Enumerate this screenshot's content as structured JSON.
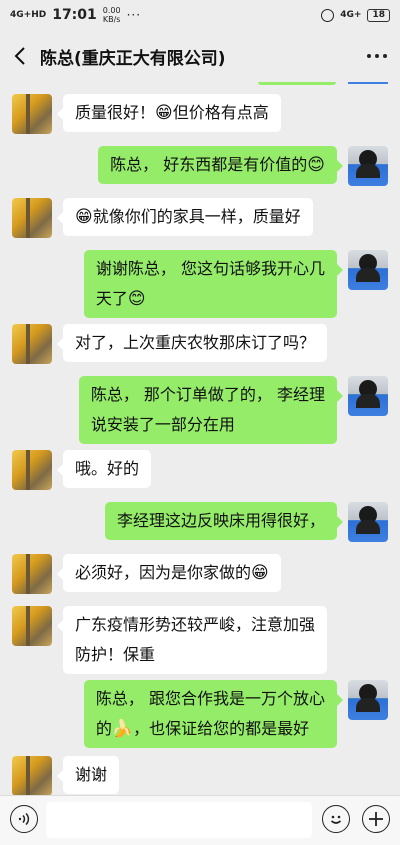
{
  "status_bar": {
    "signal": "4G+HD",
    "time": "17:01",
    "speed_value": "0.00",
    "speed_unit": "KB/s",
    "dots": "···",
    "signal_right": "4G+",
    "battery": "18"
  },
  "header": {
    "title": "陈总(重庆正大有限公司)"
  },
  "messages": [
    {
      "side": "left",
      "text": "质量很好！",
      "emoji": "😁",
      "tail": "但价格有点高"
    },
    {
      "side": "right",
      "text": "陈总， 好东西都是有价值的",
      "emoji": "😊"
    },
    {
      "side": "left",
      "emoji": "😁",
      "text": "就像你们的家具一样，质量好"
    },
    {
      "side": "right",
      "line1": "谢谢陈总， 您这句话够我开心几",
      "line2": "天了",
      "emoji": "😊"
    },
    {
      "side": "left",
      "text": "对了，上次重庆农牧那床订了吗？"
    },
    {
      "side": "right",
      "line1": "陈总， 那个订单做了的， 李经理",
      "line2": "说安装了一部分在用"
    },
    {
      "side": "left",
      "text": "哦。好的"
    },
    {
      "side": "right",
      "text": "李经理这边反映床用得很好，"
    },
    {
      "side": "left",
      "text": "必须好，因为是你家做的",
      "emoji": "😁"
    },
    {
      "side": "left",
      "line1": "广东疫情形势还较严峻，注意加强",
      "line2": "防护！保重"
    },
    {
      "side": "right",
      "line1": "陈总， 跟您合作我是一万个放心",
      "line2_pre": "的",
      "emoji": "🍌",
      "line2_post": "，也保证给您的都是最好"
    },
    {
      "side": "left",
      "text": "谢谢"
    }
  ],
  "input_bar": {
    "voice_icon": "voice-icon",
    "emoji_icon": "emoji-icon",
    "plus_icon": "plus-icon"
  }
}
